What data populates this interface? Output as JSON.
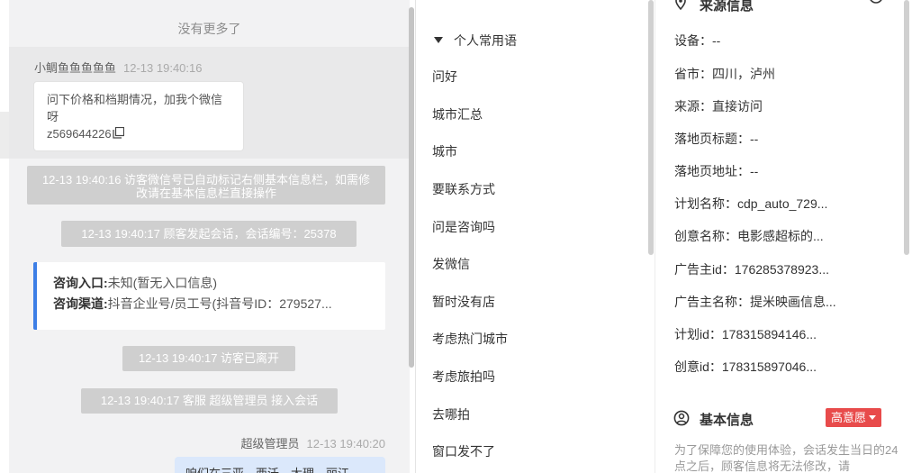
{
  "chat": {
    "no_more": "没有更多了",
    "visitor_msg": {
      "nick": "小鲷鱼鱼鱼鱼鱼",
      "time": "12-13 19:40:16",
      "text": "问下价格和档期情况，加我个微信呀",
      "wechat": "z569644226"
    },
    "system_msgs": [
      "12-13 19:40:16 访客微信号已自动标记右侧基本信息栏，如需修改请在基本信息栏直接操作",
      "12-13 19:40:17 顾客发起会话，会话编号：25378",
      "12-13 19:40:17 访客已离开",
      "12-13 19:40:17 客服 超级管理员 接入会话"
    ],
    "entry_card": {
      "entry_label": "咨询入口:",
      "entry_value": "未知(暂无入口信息)",
      "channel_label": "咨询渠道:",
      "channel_value": "抖音企业号/员工号(抖音号ID：279527..."
    },
    "agent_msg": {
      "nick": "超级管理员",
      "time": "12-13 19:40:20",
      "text": "咱们在三亚、西沃、大理、丽江..."
    }
  },
  "phrases": {
    "group_title": "个人常用语",
    "items": [
      "问好",
      "城市汇总",
      "城市",
      "要联系方式",
      "问是咨询吗",
      "发微信",
      "暂时没有店",
      "考虑热门城市",
      "考虑旅拍吗",
      "去哪拍",
      "窗口发不了"
    ]
  },
  "info": {
    "source_title": "来源信息",
    "source_rows": [
      "设备：--",
      "省市：四川，泸州",
      "来源：直接访问",
      "落地页标题：--",
      "落地页地址：--",
      "计划名称：cdp_auto_729...",
      "创意名称：电影感超标的...",
      "广告主id：176285378923...",
      "广告主名称：提米映画信息...",
      "计划id：178315894146...",
      "创意id：178315897046..."
    ],
    "basic_title": "基本信息",
    "intent_badge": "高意愿",
    "notice": "为了保障您的使用体验，会话发生当日的24点之后，顾客信息将无法修改，请"
  },
  "colors": {
    "accent_blue": "#3d7fe6",
    "badge_red": "#e84b4b",
    "system_gray": "#cfcfcf"
  }
}
